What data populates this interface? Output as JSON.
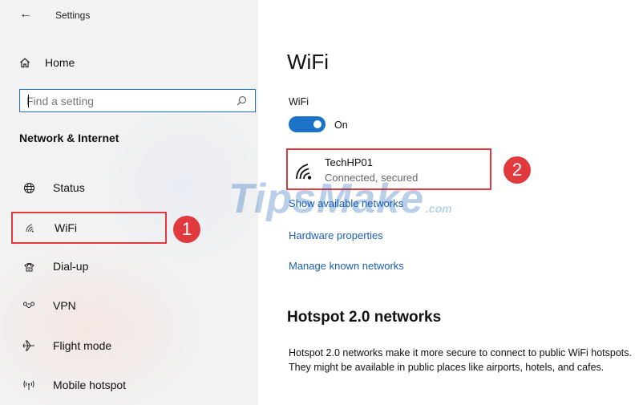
{
  "window": {
    "title": "Settings"
  },
  "sidebar": {
    "home_label": "Home",
    "search_placeholder": "Find a setting",
    "section_title": "Network & Internet",
    "items": [
      {
        "label": "Status",
        "icon": "globe-icon"
      },
      {
        "label": "WiFi",
        "icon": "wifi-icon",
        "selected": true,
        "annotation": "1"
      },
      {
        "label": "Dial-up",
        "icon": "phone-icon"
      },
      {
        "label": "VPN",
        "icon": "vpn-icon"
      },
      {
        "label": "Flight mode",
        "icon": "airplane-icon"
      },
      {
        "label": "Mobile hotspot",
        "icon": "hotspot-icon"
      }
    ]
  },
  "main": {
    "title": "WiFi",
    "wifi_toggle": {
      "label": "WiFi",
      "state": "On",
      "on": true
    },
    "network": {
      "name": "TechHP01",
      "status": "Connected, secured",
      "annotation": "2"
    },
    "links": {
      "show_networks": "Show available networks",
      "hardware": "Hardware properties",
      "manage": "Manage known networks"
    },
    "hotspot": {
      "title": "Hotspot 2.0 networks",
      "description": "Hotspot 2.0 networks make it more secure to connect to public WiFi hotspots. They might be available in public places like airports, hotels, and cafes."
    }
  },
  "watermark": {
    "main": "TipsMake",
    "sub": ".com"
  },
  "colors": {
    "accent": "#1a73c7",
    "link": "#1a5fb4",
    "annotation": "#e0393e",
    "sidebar_bg": "#f2f2f2"
  }
}
